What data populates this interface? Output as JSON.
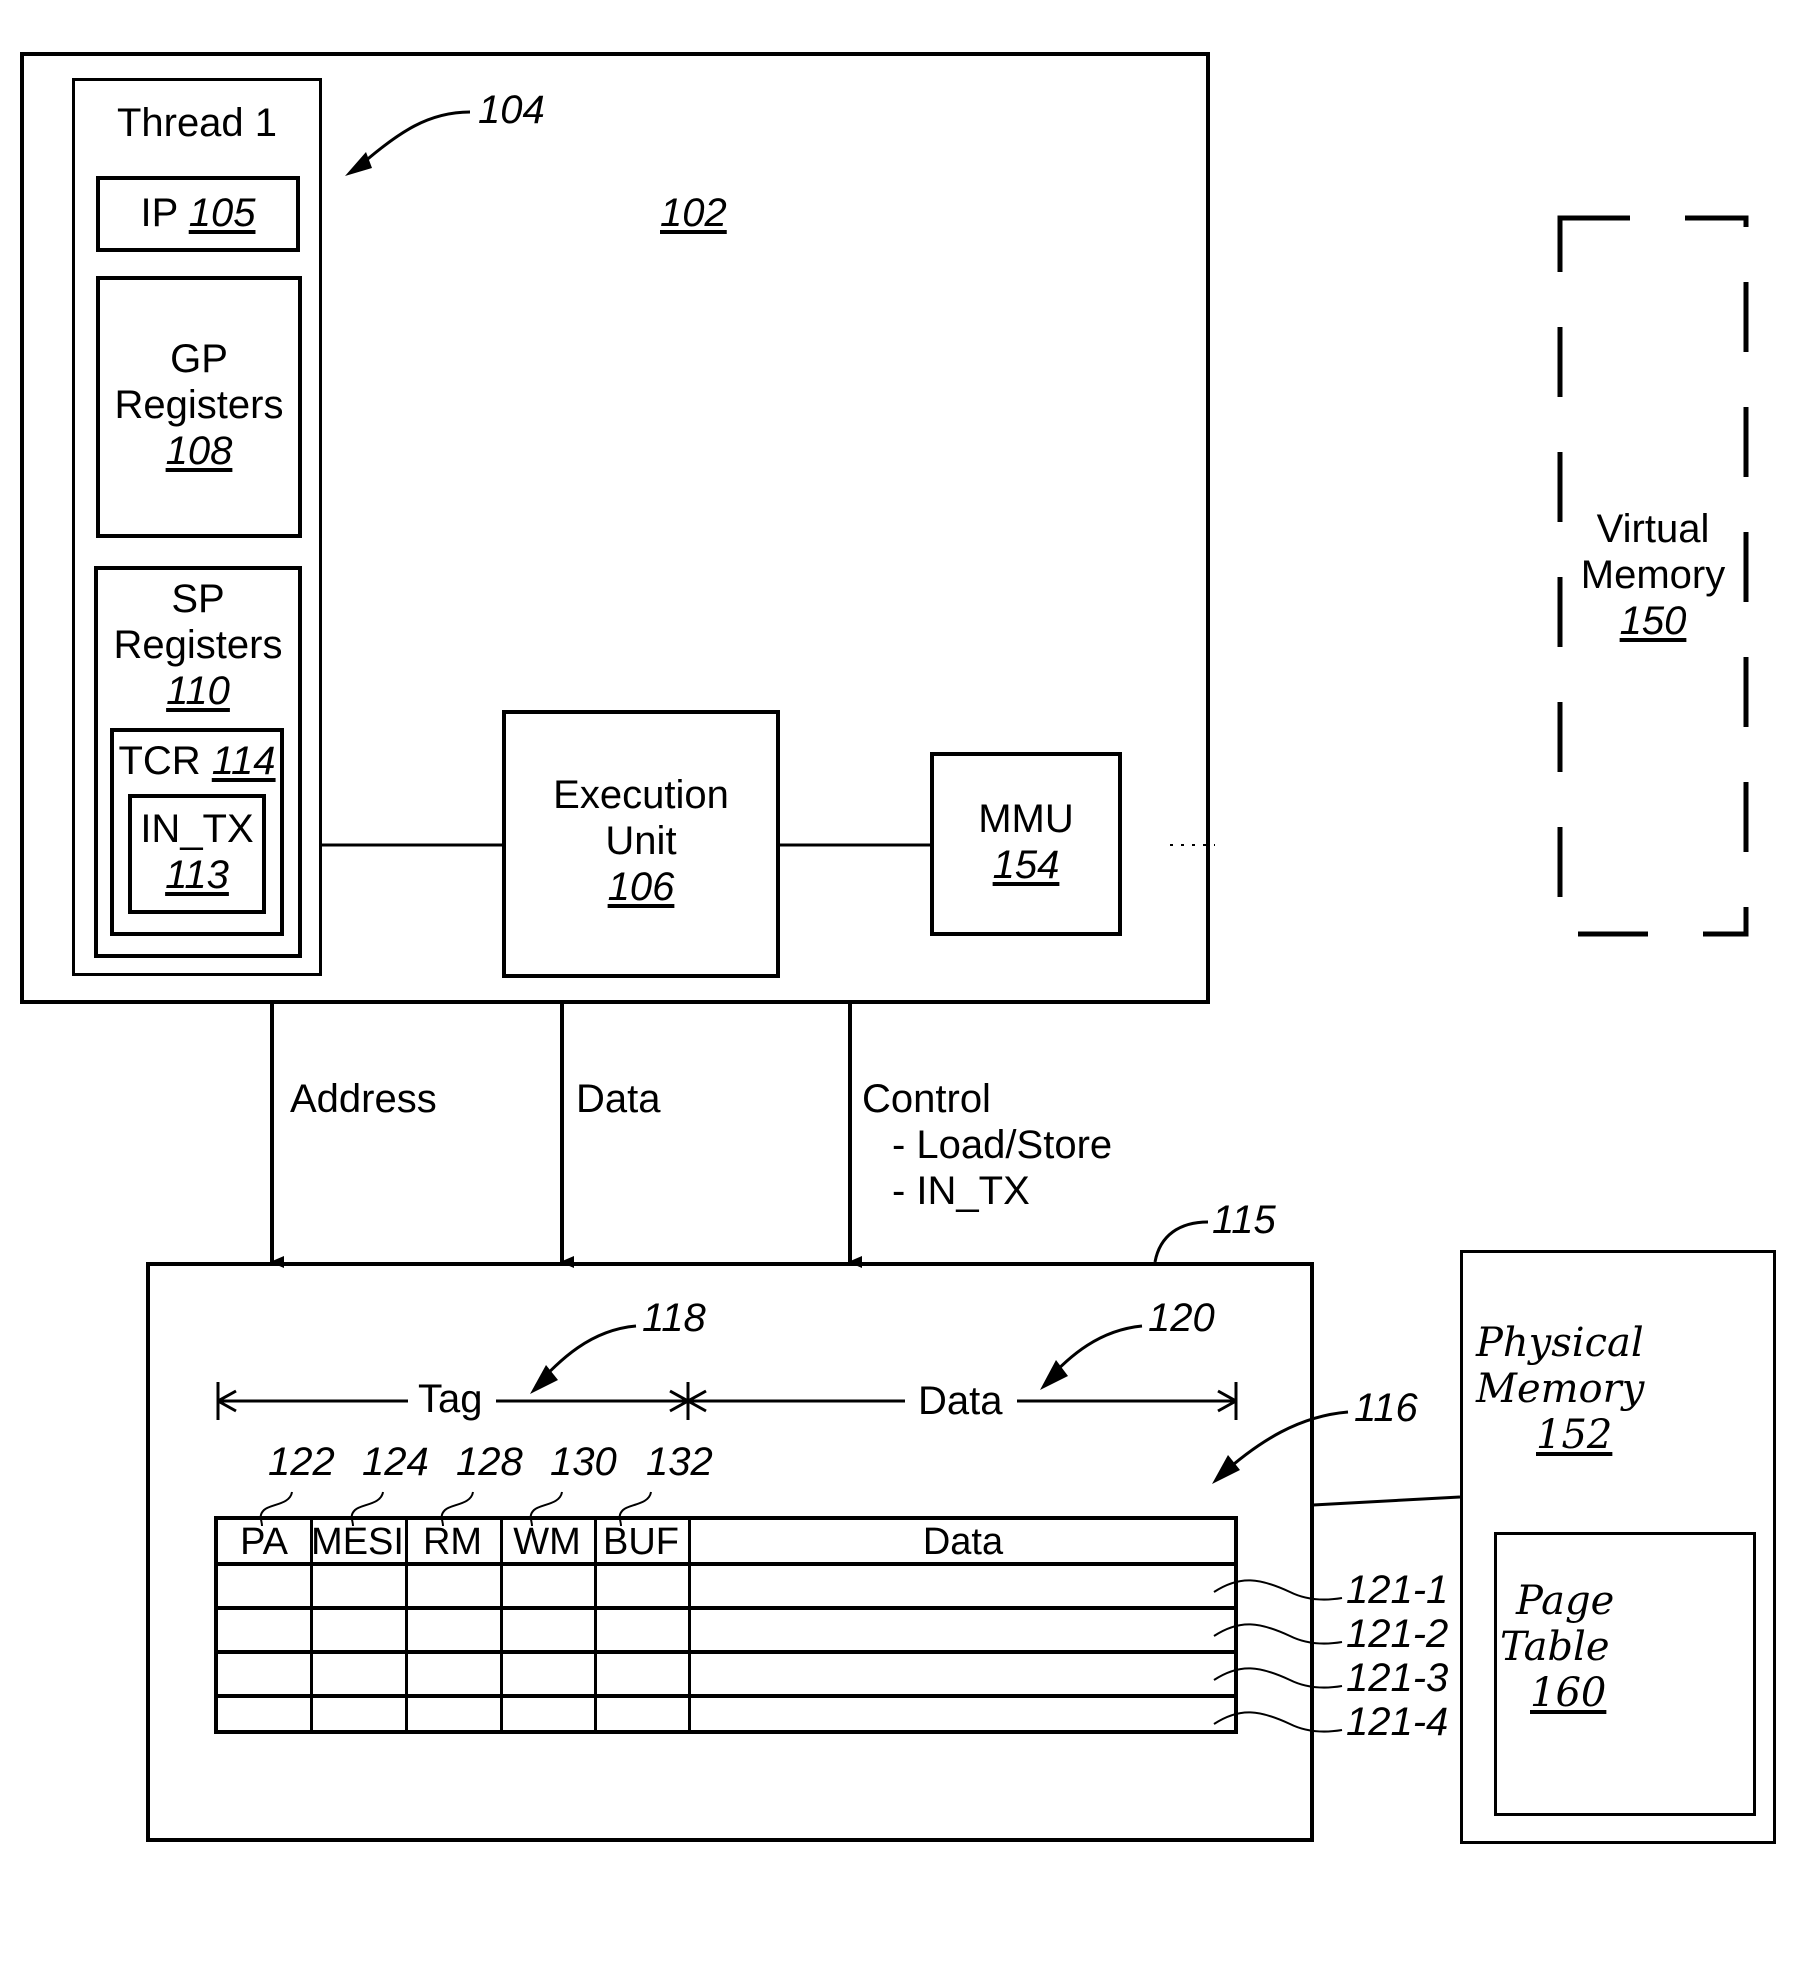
{
  "processor": {
    "ref": "102",
    "pointer_ref": "104",
    "thread": {
      "title": "Thread 1",
      "ip": {
        "label": "IP",
        "ref": "105"
      },
      "gp_registers": {
        "line1": "GP",
        "line2": "Registers",
        "ref": "108"
      },
      "sp_registers": {
        "line1": "SP",
        "line2": "Registers",
        "ref": "110",
        "tcr": {
          "label": "TCR",
          "ref": "114",
          "in_tx": {
            "label": "IN_TX",
            "ref": "113"
          }
        }
      }
    },
    "execution_unit": {
      "line1": "Execution",
      "line2": "Unit",
      "ref": "106"
    },
    "mmu": {
      "label": "MMU",
      "ref": "154"
    }
  },
  "virtual_memory": {
    "line1": "Virtual",
    "line2": "Memory",
    "ref": "150"
  },
  "buses": {
    "address": "Address",
    "data": "Data",
    "control": {
      "title": "Control",
      "items": [
        "- Load/Store",
        "- IN_TX"
      ]
    }
  },
  "cache": {
    "ref": "115",
    "lines_ref": "116",
    "tag": {
      "label": "Tag",
      "ref": "118"
    },
    "data_section": {
      "label": "Data",
      "ref": "120"
    },
    "columns": [
      {
        "label": "PA",
        "ref": "122"
      },
      {
        "label": "MESI",
        "ref": "124"
      },
      {
        "label": "RM",
        "ref": "128"
      },
      {
        "label": "WM",
        "ref": "130"
      },
      {
        "label": "BUF",
        "ref": "132"
      },
      {
        "label": "Data",
        "ref": ""
      }
    ],
    "rows": [
      "121-1",
      "121-2",
      "121-3",
      "121-4"
    ]
  },
  "physical_memory": {
    "line1": "Physical",
    "line2": "Memory",
    "ref": "152",
    "page_table": {
      "line1": "Page",
      "line2": "Table",
      "ref": "160"
    }
  }
}
